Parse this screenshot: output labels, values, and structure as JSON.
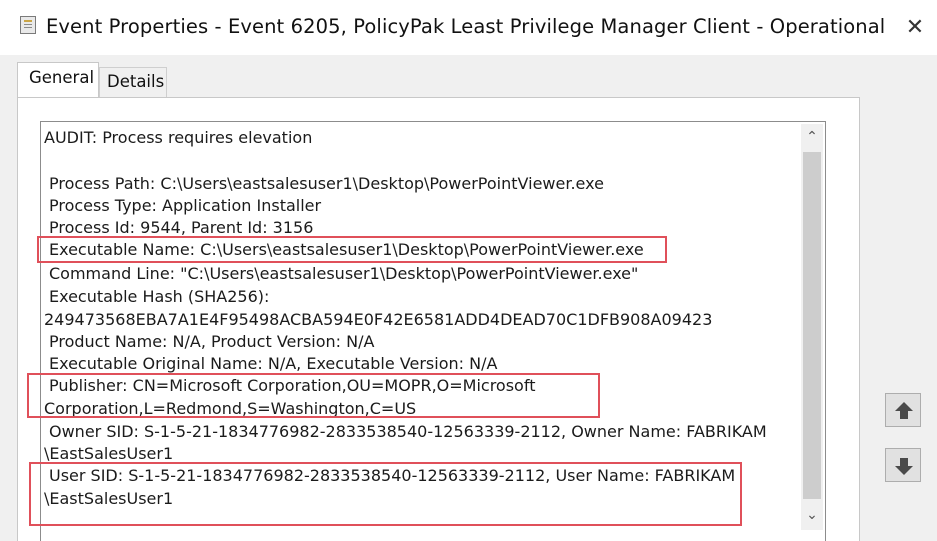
{
  "window": {
    "title": "Event Properties - Event 6205, PolicyPak Least Privilege Manager Client - Operational",
    "icon": "event-viewer-icon",
    "close_glyph": "✕"
  },
  "tabs": [
    {
      "label": "General",
      "selected": true
    },
    {
      "label": "Details",
      "selected": false
    }
  ],
  "event_text": {
    "lines": [
      "AUDIT: Process requires elevation",
      "Process Path: C:\\Users\\eastsalesuser1\\Desktop\\PowerPointViewer.exe",
      "Process Type: Application Installer",
      "Process Id: 9544, Parent Id: 3156",
      "Executable Name: C:\\Users\\eastsalesuser1\\Desktop\\PowerPointViewer.exe",
      "Command Line: \"C:\\Users\\eastsalesuser1\\Desktop\\PowerPointViewer.exe\"",
      "Executable Hash (SHA256):",
      "249473568EBA7A1E4F95498ACBA594E0F42E6581ADD4DEAD70C1DFB908A09423",
      "Product Name: N/A, Product Version: N/A",
      "Executable Original Name: N/A, Executable Version: N/A",
      "Publisher: CN=Microsoft Corporation,OU=MOPR,O=Microsoft",
      "Corporation,L=Redmond,S=Washington,C=US",
      "Owner SID: S-1-5-21-1834776982-2833538540-12563339-2112, Owner Name: FABRIKAM",
      "\\EastSalesUser1",
      "User SID: S-1-5-21-1834776982-2833538540-12563339-2112, User Name: FABRIKAM",
      "\\EastSalesUser1"
    ]
  },
  "highlight_color": "#e0505a",
  "scroll": {
    "up_glyph": "⌃",
    "down_glyph": "⌄"
  },
  "nav": {
    "up_icon": "arrow-up-icon",
    "down_icon": "arrow-down-icon"
  }
}
